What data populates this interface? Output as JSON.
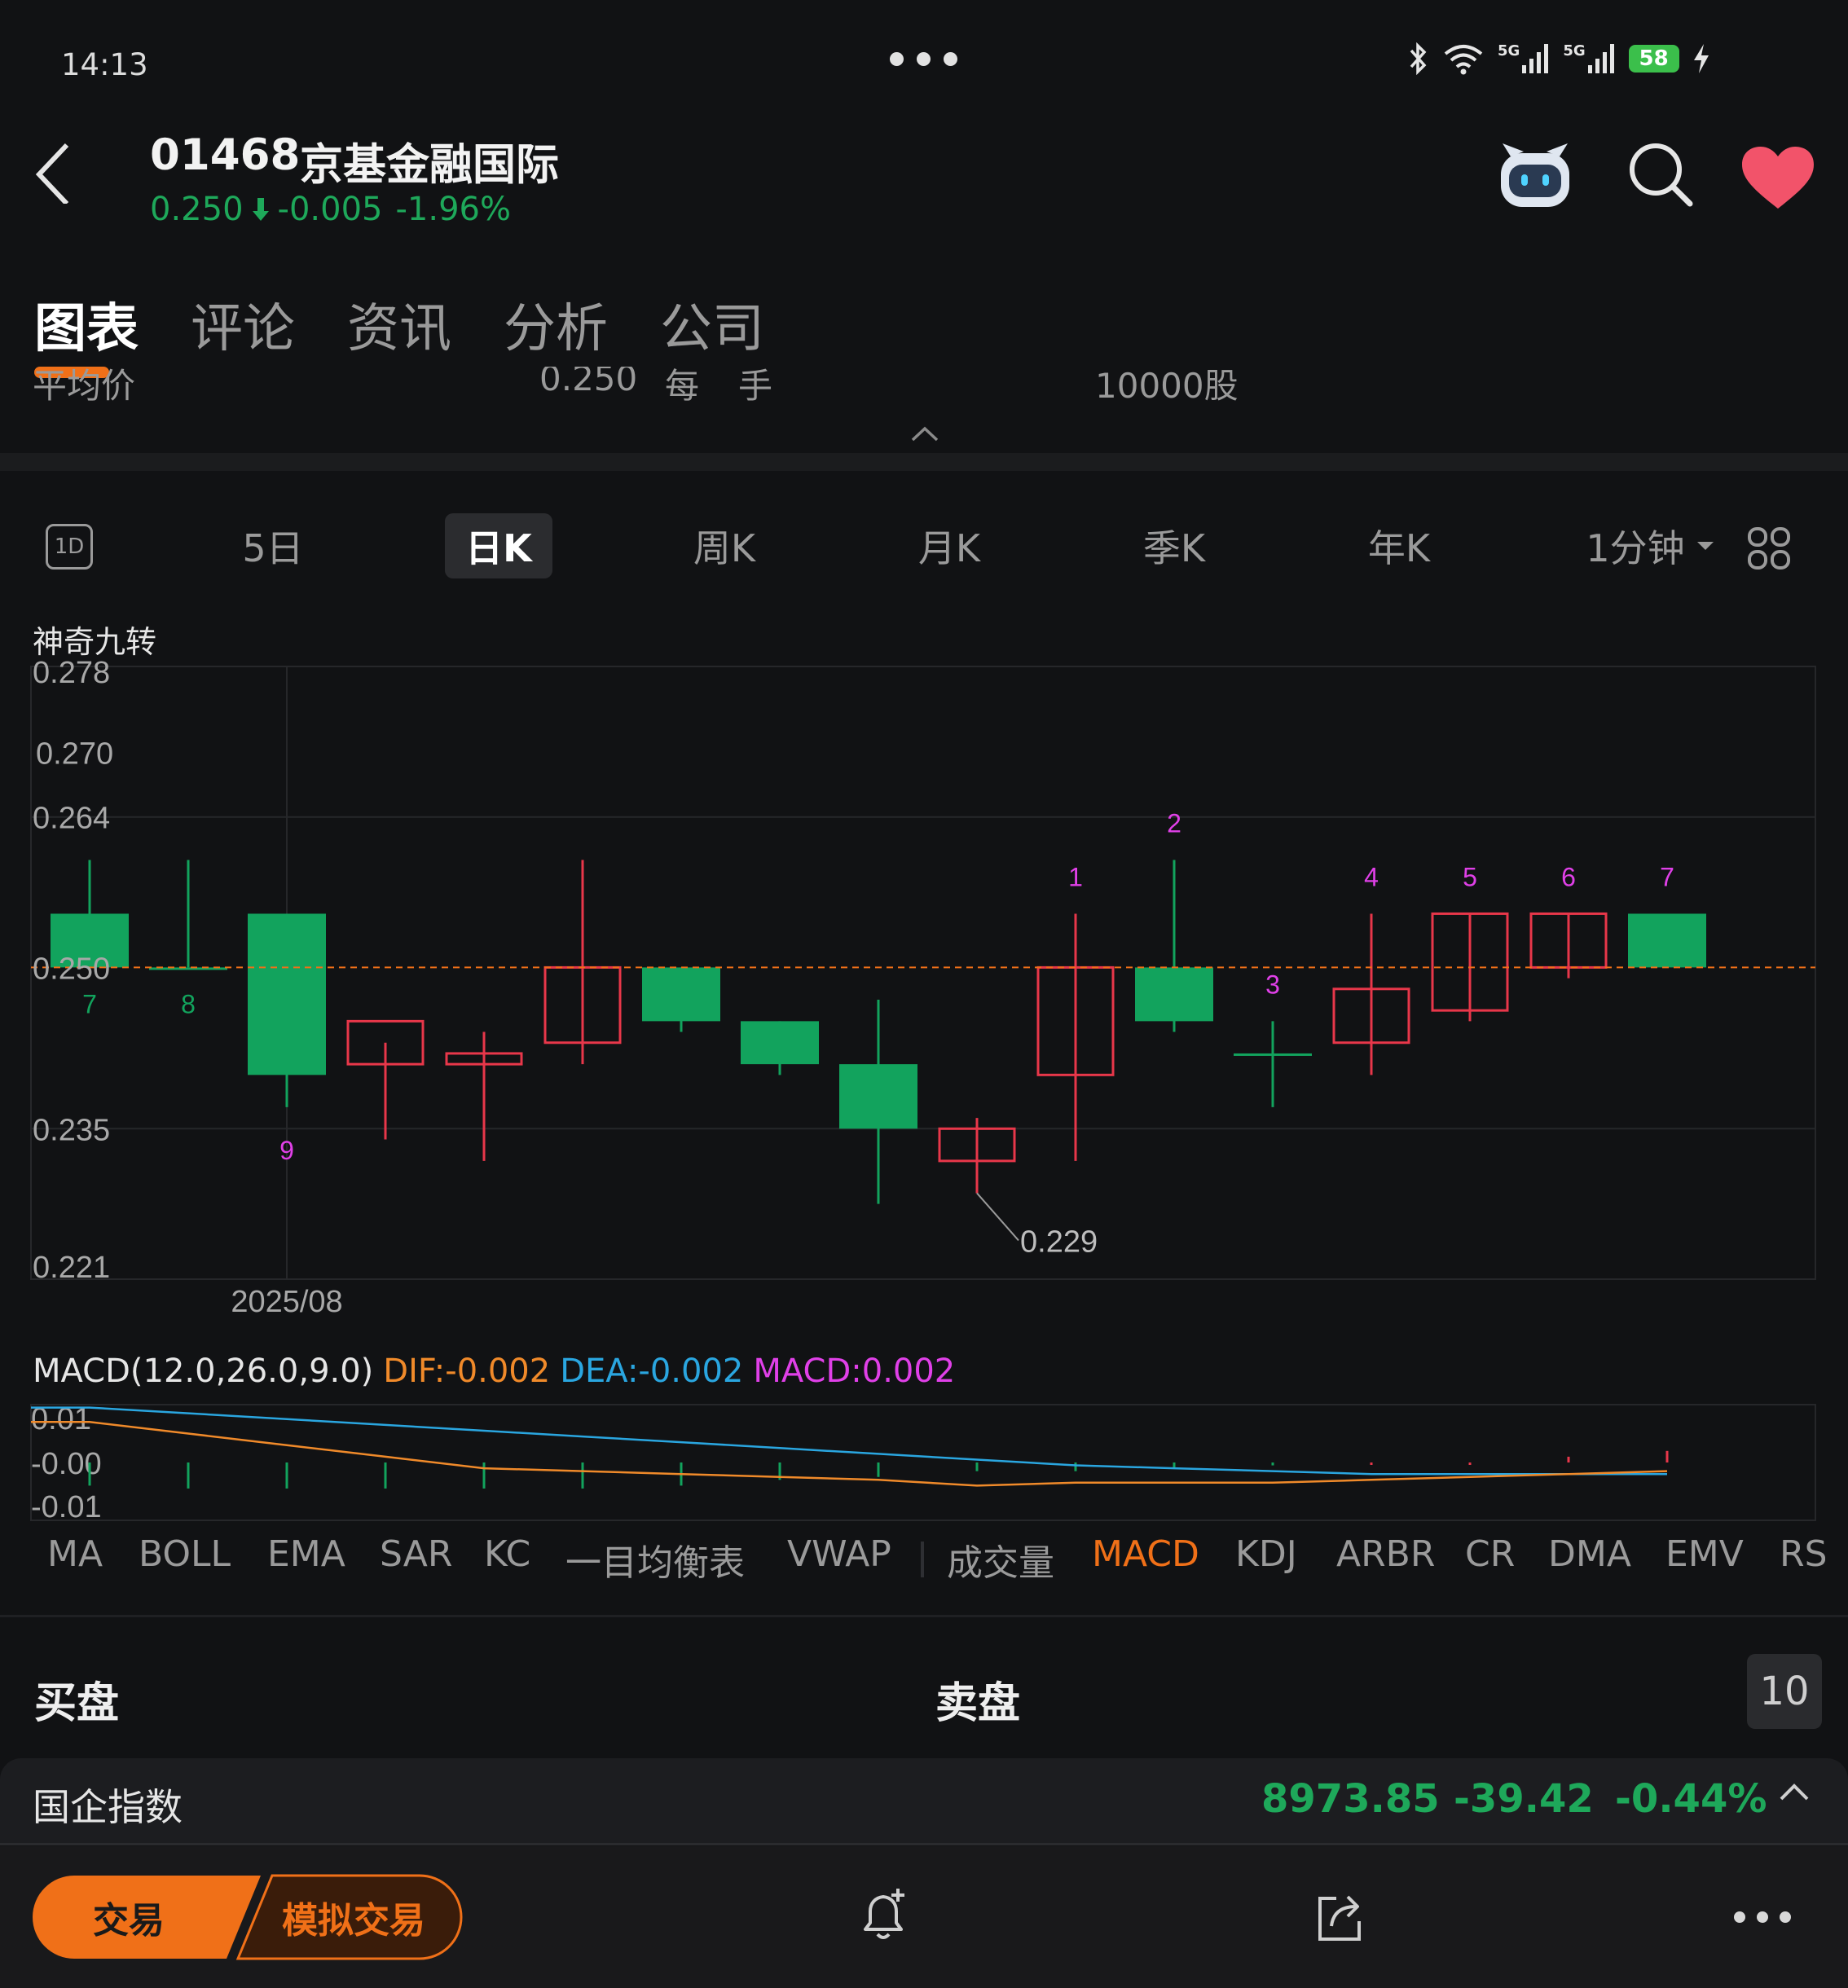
{
  "status_bar": {
    "time": "14:13",
    "network_1": "5G",
    "network_2": "5G",
    "battery": "58"
  },
  "header": {
    "stock_code": "01468",
    "stock_name": "京基金融国际",
    "price": "0.250",
    "change": "-0.005",
    "change_pct": "-1.96%",
    "price_color": "#1ea85a"
  },
  "tabs": [
    "图表",
    "评论",
    "资讯",
    "分析",
    "公司"
  ],
  "info_row": {
    "label": "平均价",
    "value": "0.250",
    "lot_label_1": "每",
    "lot_label_2": "手",
    "lot_value": "10000股"
  },
  "periods": {
    "intraday_icon": "1D",
    "items": [
      "5日",
      "日K",
      "周K",
      "月K",
      "季K",
      "年K"
    ],
    "active": "日K",
    "interval": "1分钟"
  },
  "indicator_name": "神奇九转",
  "chart_data": {
    "type": "candlestick",
    "y_ticks": [
      "0.278",
      "0.270",
      "0.264",
      "0.250",
      "0.235",
      "0.221"
    ],
    "x_label": "2025/08",
    "ylim": [
      0.221,
      0.278
    ],
    "reference_line": 0.25,
    "min_annotation": "0.229",
    "up_color": "#e8374a",
    "down_color": "#12a35d",
    "candles": [
      {
        "open": 0.255,
        "high": 0.26,
        "low": 0.25,
        "close": 0.25,
        "count": "7"
      },
      {
        "open": 0.25,
        "high": 0.26,
        "low": 0.25,
        "close": 0.25,
        "count": "8"
      },
      {
        "open": 0.255,
        "high": 0.255,
        "low": 0.237,
        "close": 0.24,
        "count": "9"
      },
      {
        "open": 0.241,
        "high": 0.243,
        "low": 0.234,
        "close": 0.245,
        "count": ""
      },
      {
        "open": 0.241,
        "high": 0.244,
        "low": 0.232,
        "close": 0.242,
        "count": ""
      },
      {
        "open": 0.243,
        "high": 0.26,
        "low": 0.241,
        "close": 0.25,
        "count": ""
      },
      {
        "open": 0.25,
        "high": 0.25,
        "low": 0.244,
        "close": 0.245,
        "count": ""
      },
      {
        "open": 0.245,
        "high": 0.245,
        "low": 0.24,
        "close": 0.241,
        "count": ""
      },
      {
        "open": 0.241,
        "high": 0.247,
        "low": 0.228,
        "close": 0.235,
        "count": ""
      },
      {
        "open": 0.232,
        "high": 0.236,
        "low": 0.229,
        "close": 0.235,
        "count": ""
      },
      {
        "open": 0.24,
        "high": 0.255,
        "low": 0.232,
        "close": 0.25,
        "count": "1"
      },
      {
        "open": 0.25,
        "high": 0.26,
        "low": 0.244,
        "close": 0.245,
        "count": "2"
      },
      {
        "open": 0.242,
        "high": 0.245,
        "low": 0.237,
        "close": 0.242,
        "count": "3"
      },
      {
        "open": 0.243,
        "high": 0.255,
        "low": 0.24,
        "close": 0.248,
        "count": "4"
      },
      {
        "open": 0.246,
        "high": 0.255,
        "low": 0.245,
        "close": 0.255,
        "count": "5"
      },
      {
        "open": 0.25,
        "high": 0.255,
        "low": 0.249,
        "close": 0.255,
        "count": "6"
      },
      {
        "open": 0.255,
        "high": 0.255,
        "low": 0.25,
        "close": 0.25,
        "count": "7"
      }
    ]
  },
  "macd": {
    "label": "MACD(12.0,26.0,9.0)",
    "dif": "DIF:-0.002",
    "dea": "DEA:-0.002",
    "macd": "MACD:0.002",
    "dif_color": "#f08a2a",
    "dea_color": "#2aa6e0",
    "macd_color": "#e040e8",
    "y_ticks": [
      "0.01",
      "-0.00",
      "-0.01"
    ],
    "ylim": [
      -0.01,
      0.01
    ],
    "dif_values": [
      0.007,
      0.005,
      0.003,
      0.001,
      -0.001,
      -0.0015,
      -0.002,
      -0.0025,
      -0.003,
      -0.004,
      -0.0035,
      -0.0035,
      -0.0035,
      -0.003,
      -0.0025,
      -0.002,
      -0.0015
    ],
    "dea_values": [
      0.0095,
      0.0085,
      0.0075,
      0.0065,
      0.0055,
      0.0045,
      0.0035,
      0.0025,
      0.0015,
      0.0005,
      -0.0005,
      -0.001,
      -0.0015,
      -0.002,
      -0.002,
      -0.002,
      -0.002
    ],
    "hist_values": [
      -0.004,
      -0.0045,
      -0.0045,
      -0.0045,
      -0.0045,
      -0.0045,
      -0.004,
      -0.003,
      -0.0025,
      -0.0015,
      -0.0015,
      -0.001,
      -0.0005,
      0.0,
      0.0,
      0.001,
      0.002
    ]
  },
  "indicators": {
    "items": [
      "MA",
      "BOLL",
      "EMA",
      "SAR",
      "KC",
      "一目均衡表",
      "VWAP",
      "成交量",
      "MACD",
      "KDJ",
      "ARBR",
      "CR",
      "DMA",
      "EMV",
      "RS"
    ],
    "active": "MACD"
  },
  "order_book": {
    "bid_label": "买盘",
    "ask_label": "卖盘",
    "depth": "10"
  },
  "index_bar": {
    "name": "国企指数",
    "value": "8973.85",
    "change": "-39.42",
    "change_pct": "-0.44%"
  },
  "bottom_bar": {
    "trade_label": "交易",
    "sim_trade_label": "模拟交易",
    "accent": "#f07018"
  }
}
